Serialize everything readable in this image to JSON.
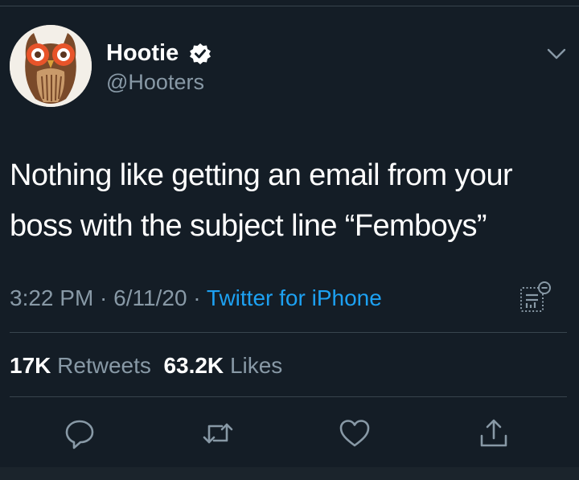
{
  "tweet": {
    "author": {
      "name": "Hootie",
      "handle": "@Hooters",
      "verified": true
    },
    "text": "Nothing like getting an email from your boss with the subject line “Femboys”",
    "time": "3:22 PM",
    "separator": " · ",
    "date": "6/11/20",
    "source": "Twitter for iPhone",
    "stats": {
      "retweets_count": "17K",
      "retweets_label": "Retweets",
      "likes_count": "63.2K",
      "likes_label": "Likes"
    }
  },
  "icons": [
    "owl-avatar",
    "verified-badge-icon",
    "chevron-down-icon",
    "analytics-icon",
    "reply-icon",
    "retweet-icon",
    "like-icon",
    "share-icon"
  ],
  "colors": {
    "background": "#141d26",
    "text": "#ffffff",
    "secondary": "#8899a6",
    "link": "#1da1f2",
    "divider": "#38444d"
  }
}
